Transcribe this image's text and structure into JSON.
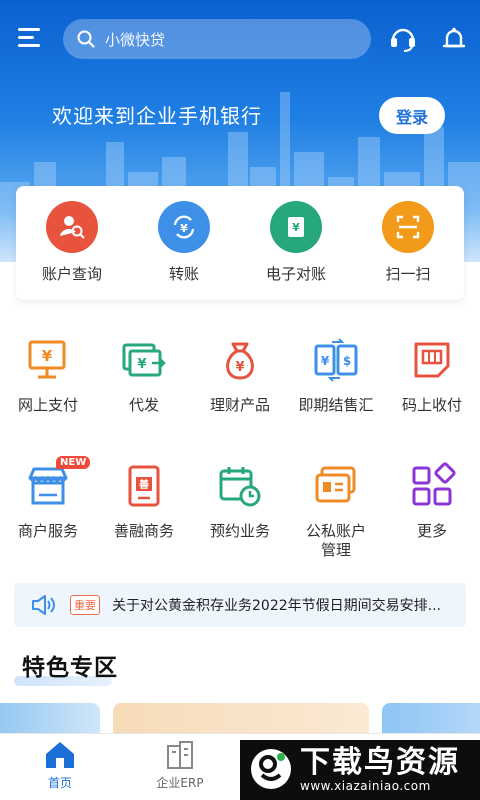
{
  "header": {
    "search_placeholder": "小微快贷",
    "welcome": "欢迎来到企业手机银行",
    "login_label": "登录"
  },
  "quick_actions": [
    {
      "label": "账户查询",
      "icon": "account-query-icon",
      "color": "#e8533e"
    },
    {
      "label": "转账",
      "icon": "transfer-icon",
      "color": "#3d8fe8"
    },
    {
      "label": "电子对账",
      "icon": "e-reconciliation-icon",
      "color": "#27a77e"
    },
    {
      "label": "扫一扫",
      "icon": "scan-icon",
      "color": "#f29a1a"
    }
  ],
  "grid_row1": [
    {
      "label": "网上支付",
      "icon": "online-pay-icon"
    },
    {
      "label": "代发",
      "icon": "payroll-icon"
    },
    {
      "label": "理财产品",
      "icon": "wealth-bag-icon"
    },
    {
      "label": "即期结售汇",
      "icon": "fx-exchange-icon"
    },
    {
      "label": "码上收付",
      "icon": "code-pay-icon"
    }
  ],
  "grid_row2": [
    {
      "label": "商户服务",
      "icon": "merchant-store-icon",
      "badge": "NEW"
    },
    {
      "label": "善融商务",
      "icon": "shanrong-icon"
    },
    {
      "label": "预约业务",
      "icon": "calendar-clock-icon"
    },
    {
      "label": "公私账户\n管理",
      "icon": "account-card-icon"
    },
    {
      "label": "更多",
      "icon": "more-grid-icon"
    }
  ],
  "notice": {
    "tag": "重要",
    "text": "关于对公黄金积存业务2022年节假日期间交易安排..."
  },
  "feature": {
    "title": "特色专区"
  },
  "tabbar": [
    {
      "label": "首页",
      "icon": "home-icon",
      "active": true
    },
    {
      "label": "企业ERP",
      "icon": "erp-building-icon",
      "active": false
    }
  ],
  "watermark": {
    "name": "下载鸟资源",
    "url": "www.xiazainiao.com"
  },
  "colors": {
    "brand_blue": "#1b6fd6",
    "orange": "#f08a24",
    "green": "#27a77e",
    "red": "#e8533e",
    "purple": "#8b35d6"
  }
}
